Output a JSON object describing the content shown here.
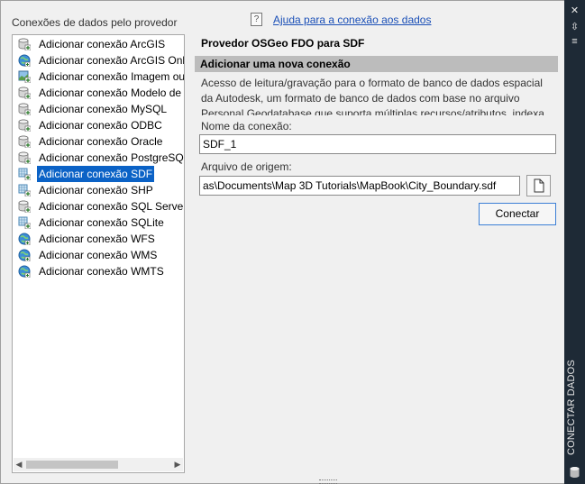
{
  "providers_title": "Conexões de dados pelo provedor",
  "help": {
    "icon": "?",
    "link_text": "Ajuda para a conexão aos dados"
  },
  "providers": [
    {
      "label": "Adicionar conexão ArcGIS",
      "icon": "db-icon"
    },
    {
      "label": "Adicionar conexão ArcGIS Online",
      "icon": "globe-icon"
    },
    {
      "label": "Adicionar conexão Imagem ou superfície",
      "icon": "raster-icon"
    },
    {
      "label": "Adicionar conexão Modelo de dados",
      "icon": "db-icon"
    },
    {
      "label": "Adicionar conexão MySQL",
      "icon": "db-icon"
    },
    {
      "label": "Adicionar conexão ODBC",
      "icon": "db-icon"
    },
    {
      "label": "Adicionar conexão Oracle",
      "icon": "db-icon"
    },
    {
      "label": "Adicionar conexão PostgreSQL",
      "icon": "db-icon"
    },
    {
      "label": "Adicionar conexão SDF",
      "icon": "grid-icon",
      "selected": true
    },
    {
      "label": "Adicionar conexão SHP",
      "icon": "grid-icon"
    },
    {
      "label": "Adicionar conexão SQL Server",
      "icon": "db-icon"
    },
    {
      "label": "Adicionar conexão SQLite",
      "icon": "grid-icon"
    },
    {
      "label": "Adicionar conexão WFS",
      "icon": "globe-icon"
    },
    {
      "label": "Adicionar conexão WMS",
      "icon": "globe-icon"
    },
    {
      "label": "Adicionar conexão WMTS",
      "icon": "globe-icon"
    }
  ],
  "provider_title": "Provedor OSGeo FDO para SDF",
  "section_title": "Adicionar uma nova conexão",
  "description": "Acesso de leitura/gravação para o formato de banco de dados espacial da Autodesk, um formato de banco de dados com base no arquivo Personal Geodatabase que suporta múltiplas recursos/atributos, indexa",
  "connection_name": {
    "label": "Nome da conexão:",
    "value": "SDF_1"
  },
  "source_file": {
    "label": "Arquivo de origem:",
    "value": "as\\Documents\\Map 3D Tutorials\\MapBook\\City_Boundary.sdf"
  },
  "connect_button": "Conectar",
  "side_panel": {
    "title": "CONECTAR DADOS"
  },
  "colors": {
    "selection": "#0b62c6",
    "section_bar": "#bcbcbc",
    "link": "#1a4fb7",
    "side_strip": "#1e2a36"
  }
}
